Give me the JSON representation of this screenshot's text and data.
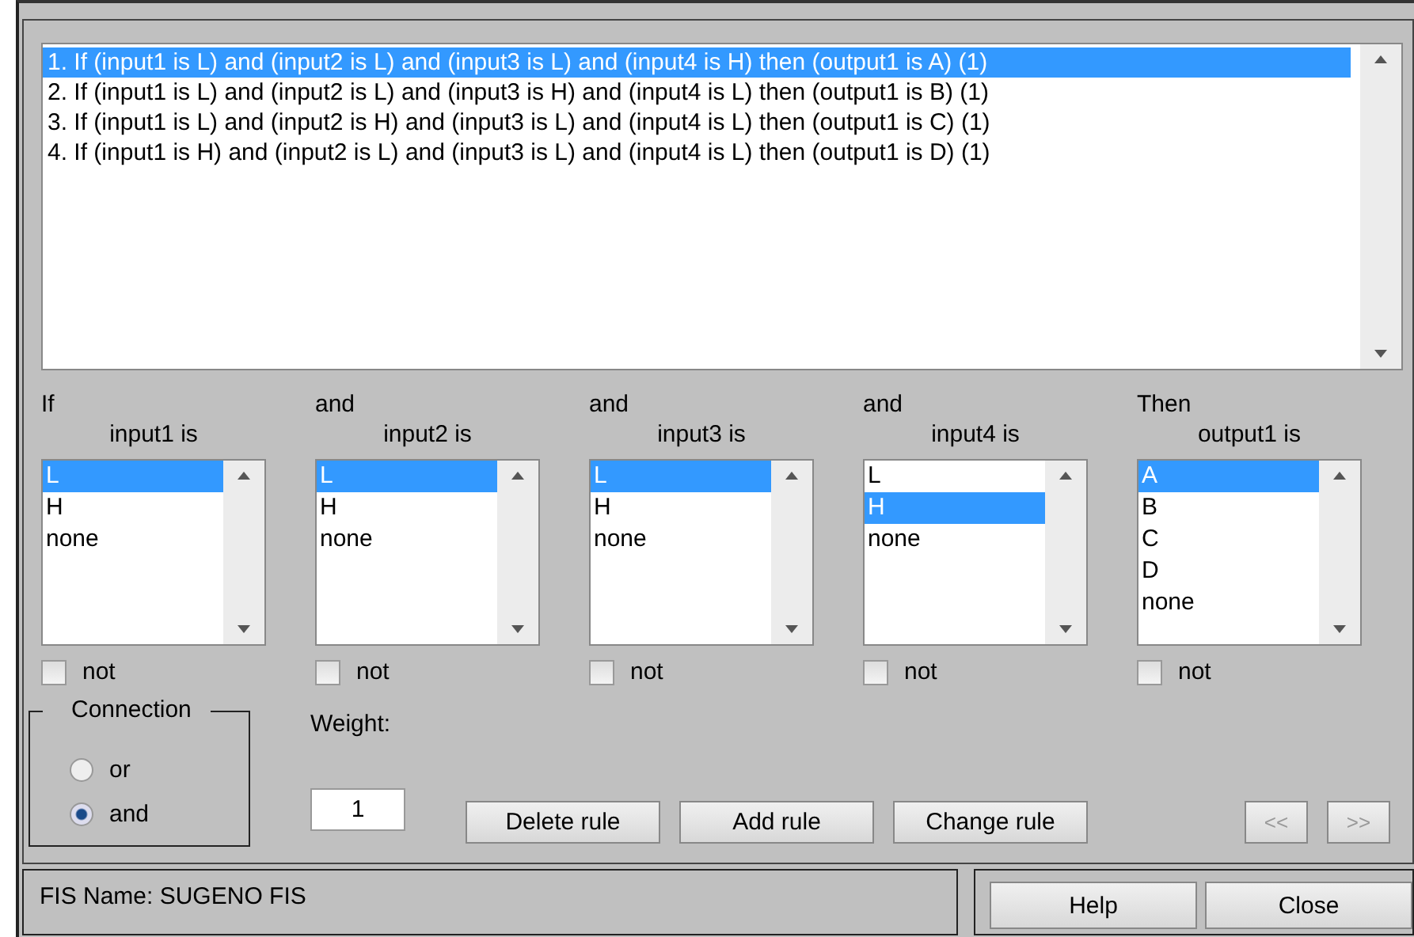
{
  "rules": [
    {
      "text": "1. If (input1 is L) and (input2 is L) and (input3 is L) and (input4 is H) then (output1 is A) (1)",
      "selected": true
    },
    {
      "text": "2. If (input1 is L) and (input2 is L) and (input3 is H) and (input4 is L) then (output1 is B) (1)",
      "selected": false
    },
    {
      "text": "3. If (input1 is L) and (input2 is H) and (input3 is L) and (input4 is L) then (output1 is C) (1)",
      "selected": false
    },
    {
      "text": "4. If (input1 is H) and (input2 is L) and (input3 is L) and (input4 is L) then (output1 is D) (1)",
      "selected": false
    }
  ],
  "columns": [
    {
      "keyword": "If",
      "variable": "input1 is",
      "not": false,
      "not_label": "not",
      "options": [
        {
          "label": "L",
          "selected": true
        },
        {
          "label": "H",
          "selected": false
        },
        {
          "label": "none",
          "selected": false
        }
      ]
    },
    {
      "keyword": "and",
      "variable": "input2 is",
      "not": false,
      "not_label": "not",
      "options": [
        {
          "label": "L",
          "selected": true
        },
        {
          "label": "H",
          "selected": false
        },
        {
          "label": "none",
          "selected": false
        }
      ]
    },
    {
      "keyword": "and",
      "variable": "input3 is",
      "not": false,
      "not_label": "not",
      "options": [
        {
          "label": "L",
          "selected": true
        },
        {
          "label": "H",
          "selected": false
        },
        {
          "label": "none",
          "selected": false
        }
      ]
    },
    {
      "keyword": "and",
      "variable": "input4 is",
      "not": false,
      "not_label": "not",
      "options": [
        {
          "label": "L",
          "selected": false
        },
        {
          "label": "H",
          "selected": true
        },
        {
          "label": "none",
          "selected": false
        }
      ]
    },
    {
      "keyword": "Then",
      "variable": "output1 is",
      "not": false,
      "not_label": "not",
      "options": [
        {
          "label": "A",
          "selected": true
        },
        {
          "label": "B",
          "selected": false
        },
        {
          "label": "C",
          "selected": false
        },
        {
          "label": "D",
          "selected": false
        },
        {
          "label": "none",
          "selected": false
        }
      ]
    }
  ],
  "connection": {
    "title": "Connection",
    "options": [
      {
        "label": "or",
        "selected": false
      },
      {
        "label": "and",
        "selected": true
      }
    ]
  },
  "weight": {
    "label": "Weight:",
    "value": "1"
  },
  "buttons": [
    {
      "label": "Delete rule",
      "disabled": false
    },
    {
      "label": "Add rule",
      "disabled": false
    },
    {
      "label": "Change rule",
      "disabled": false
    }
  ],
  "nav_buttons": [
    {
      "label": "<<",
      "disabled": true
    },
    {
      "label": ">>",
      "disabled": true
    }
  ],
  "status": "FIS Name: SUGENO FIS",
  "footer_buttons": [
    "Help",
    "Close"
  ]
}
